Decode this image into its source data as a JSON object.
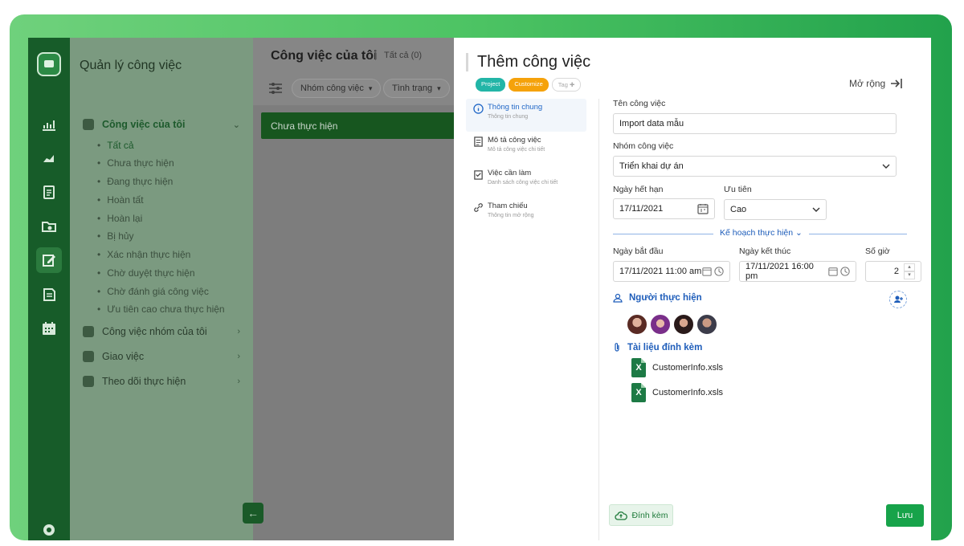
{
  "app": {
    "sidebar_title": "Quản lý công việc"
  },
  "rail": {
    "icons": [
      "logo-icon",
      "chart-bar-icon",
      "chart-area-icon",
      "clipboard-icon",
      "folder-icon",
      "edit-task-icon",
      "receipt-icon",
      "calendar-icon",
      "gear-icon"
    ]
  },
  "sidebar": {
    "groups": [
      {
        "label": "Công việc của tôi"
      },
      {
        "label": "Công việc nhóm của tôi"
      },
      {
        "label": "Giao việc"
      },
      {
        "label": "Theo dõi thực hiện"
      }
    ],
    "items": [
      "Tất cả",
      "Chưa thực hiện",
      "Đang thực hiện",
      "Hoàn tất",
      "Hoàn lại",
      "Bị hủy",
      "Xác nhận thực hiện",
      "Chờ duyệt thực hiện",
      "Chờ đánh giá công việc",
      "Ưu tiên cao chưa thực hiện"
    ]
  },
  "main": {
    "title": "Công việc của tôi",
    "count": "Tất cả (0)",
    "filters": [
      "Nhóm công việc",
      "Tình trạng"
    ],
    "status_column": "Chưa thực hiện"
  },
  "drawer": {
    "title": "Thêm công việc",
    "tags": [
      "Project",
      "Customize",
      "Tag"
    ],
    "expand_label": "Mở rộng",
    "steps": [
      {
        "title": "Thông tin chung",
        "subtitle": "Thông tin chung"
      },
      {
        "title": "Mô tả công việc",
        "subtitle": "Mô tả công việc chi tiết"
      },
      {
        "title": "Việc cần làm",
        "subtitle": "Danh sách công việc chi tiết"
      },
      {
        "title": "Tham chiếu",
        "subtitle": "Thông tin mở rộng"
      }
    ],
    "form": {
      "task_name_label": "Tên công việc",
      "task_name_value": "Import data mẫu",
      "group_label": "Nhóm công việc",
      "group_value": "Triển khai dự án",
      "deadline_label": "Ngày hết hạn",
      "deadline_value": "17/11/2021",
      "priority_label": "Ưu tiên",
      "priority_value": "Cao",
      "plan_section": "Kế hoạch thực hiện",
      "start_label": "Ngày bắt đầu",
      "start_value": "17/11/2021 11:00 am",
      "end_label": "Ngày kết thúc",
      "end_value": "17/11/2021 16:00 pm",
      "hours_label": "Số giờ",
      "hours_value": "2",
      "assignee_heading": "Người thực hiện",
      "attachments_heading": "Tài liệu đính kèm",
      "files": [
        "CustomerInfo.xsls",
        "CustomerInfo.xsls"
      ]
    },
    "attach_button": "Đính kèm",
    "save_button": "Lưu"
  },
  "colors": {
    "brand_green": "#17a34a",
    "link_blue": "#1e5dba",
    "tag_project": "#22b5a7",
    "tag_customize": "#f5a20b"
  }
}
